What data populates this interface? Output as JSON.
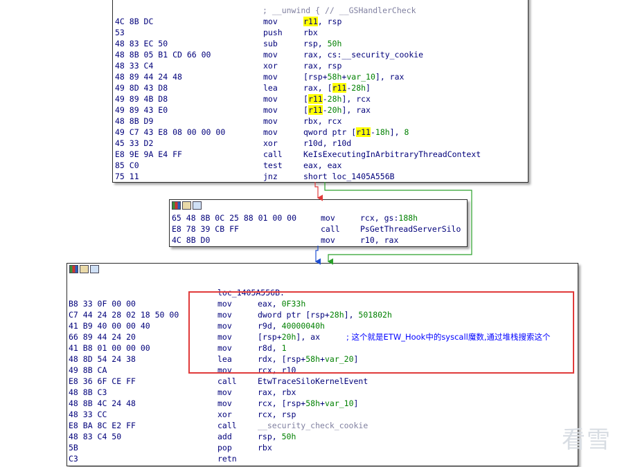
{
  "block1": {
    "header_partial": "; __unwind { // __GSHandlerCheck",
    "lines": [
      {
        "bytes": "4C 8B DC",
        "mn": "mov",
        "ops": [
          {
            "t": "r11",
            "h": true
          },
          {
            "t": ", rsp"
          }
        ]
      },
      {
        "bytes": "53",
        "mn": "push",
        "ops": [
          {
            "t": "rbx"
          }
        ]
      },
      {
        "bytes": "48 83 EC 50",
        "mn": "sub",
        "ops": [
          {
            "t": "rsp, "
          },
          {
            "t": "50h",
            "c": "num"
          }
        ]
      },
      {
        "bytes": "48 8B 05 B1 CD 66 00",
        "mn": "mov",
        "ops": [
          {
            "t": "rax, cs:__security_cookie"
          }
        ]
      },
      {
        "bytes": "48 33 C4",
        "mn": "xor",
        "ops": [
          {
            "t": "rax, rsp"
          }
        ]
      },
      {
        "bytes": "48 89 44 24 48",
        "mn": "mov",
        "ops": [
          {
            "t": "[rsp+"
          },
          {
            "t": "58h",
            "c": "num"
          },
          {
            "t": "+"
          },
          {
            "t": "var_10",
            "c": "var"
          },
          {
            "t": "], rax"
          }
        ]
      },
      {
        "bytes": "49 8D 43 D8",
        "mn": "lea",
        "ops": [
          {
            "t": "rax, ["
          },
          {
            "t": "r11",
            "h": true
          },
          {
            "t": "-"
          },
          {
            "t": "28h",
            "c": "num"
          },
          {
            "t": "]"
          }
        ]
      },
      {
        "bytes": "49 89 4B D8",
        "mn": "mov",
        "ops": [
          {
            "t": "["
          },
          {
            "t": "r11",
            "h": true
          },
          {
            "t": "-"
          },
          {
            "t": "28h",
            "c": "num"
          },
          {
            "t": "], rcx"
          }
        ]
      },
      {
        "bytes": "49 89 43 E0",
        "mn": "mov",
        "ops": [
          {
            "t": "["
          },
          {
            "t": "r11",
            "h": true
          },
          {
            "t": "-"
          },
          {
            "t": "20h",
            "c": "num"
          },
          {
            "t": "], rax"
          }
        ]
      },
      {
        "bytes": "48 8B D9",
        "mn": "mov",
        "ops": [
          {
            "t": "rbx, rcx"
          }
        ]
      },
      {
        "bytes": "49 C7 43 E8 08 00 00 00",
        "mn": "mov",
        "ops": [
          {
            "t": "qword ptr ["
          },
          {
            "t": "r11",
            "h": true
          },
          {
            "t": "-"
          },
          {
            "t": "18h",
            "c": "num"
          },
          {
            "t": "], "
          },
          {
            "t": "8",
            "c": "num"
          }
        ]
      },
      {
        "bytes": "45 33 D2",
        "mn": "xor",
        "ops": [
          {
            "t": "r10d, r10d"
          }
        ]
      },
      {
        "bytes": "E8 9E 9A E4 FF",
        "mn": "call",
        "ops": [
          {
            "t": "KeIsExecutingInArbitraryThreadContext"
          }
        ]
      },
      {
        "bytes": "85 C0",
        "mn": "test",
        "ops": [
          {
            "t": "eax, eax"
          }
        ]
      },
      {
        "bytes": "75 11",
        "mn": "jnz",
        "ops": [
          {
            "t": "short loc_1405A556B"
          }
        ]
      }
    ]
  },
  "block2": {
    "lines": [
      {
        "bytes": "65 48 8B 0C 25 88 01 00 00",
        "mn": "mov",
        "ops": [
          {
            "t": "rcx, gs:"
          },
          {
            "t": "188h",
            "c": "num"
          }
        ]
      },
      {
        "bytes": "E8 78 39 CB FF",
        "mn": "call",
        "ops": [
          {
            "t": "PsGetThreadServerSilo"
          }
        ]
      },
      {
        "bytes": "4C 8B D0",
        "mn": "mov",
        "ops": [
          {
            "t": "r10, rax"
          }
        ]
      }
    ]
  },
  "block3": {
    "label": "loc_1405A556B:",
    "comment": "; 这个就是ETW_Hook中的syscall魔数,通过堆栈搜索这个",
    "lines": [
      {
        "bytes": "B8 33 0F 00 00",
        "mn": "mov",
        "ops": [
          {
            "t": "eax, "
          },
          {
            "t": "0F33h",
            "c": "num"
          }
        ]
      },
      {
        "bytes": "C7 44 24 28 02 18 50 00",
        "mn": "mov",
        "ops": [
          {
            "t": "dword ptr [rsp+"
          },
          {
            "t": "28h",
            "c": "num"
          },
          {
            "t": "], "
          },
          {
            "t": "501802h",
            "c": "num"
          }
        ]
      },
      {
        "bytes": "41 B9 40 00 00 40",
        "mn": "mov",
        "ops": [
          {
            "t": "r9d, "
          },
          {
            "t": "40000040h",
            "c": "num"
          }
        ]
      },
      {
        "bytes": "66 89 44 24 20",
        "mn": "mov",
        "ops": [
          {
            "t": "[rsp+"
          },
          {
            "t": "20h",
            "c": "num"
          },
          {
            "t": "], ax"
          }
        ],
        "comment": true
      },
      {
        "bytes": "41 B8 01 00 00 00",
        "mn": "mov",
        "ops": [
          {
            "t": "r8d, "
          },
          {
            "t": "1",
            "c": "num"
          }
        ]
      },
      {
        "bytes": "48 8D 54 24 38",
        "mn": "lea",
        "ops": [
          {
            "t": "rdx, [rsp+"
          },
          {
            "t": "58h",
            "c": "num"
          },
          {
            "t": "+"
          },
          {
            "t": "var_20",
            "c": "var"
          },
          {
            "t": "]"
          }
        ]
      },
      {
        "bytes": "49 8B CA",
        "mn": "mov",
        "ops": [
          {
            "t": "rcx, r10"
          }
        ]
      },
      {
        "bytes": "E8 36 6F CE FF",
        "mn": "call",
        "ops": [
          {
            "t": "EtwTraceSiloKernelEvent"
          }
        ]
      },
      {
        "bytes": "48 8B C3",
        "mn": "mov",
        "ops": [
          {
            "t": "rax, rbx"
          }
        ]
      },
      {
        "bytes": "48 8B 4C 24 48",
        "mn": "mov",
        "ops": [
          {
            "t": "rcx, [rsp+"
          },
          {
            "t": "58h",
            "c": "num"
          },
          {
            "t": "+"
          },
          {
            "t": "var_10",
            "c": "var"
          },
          {
            "t": "]"
          }
        ]
      },
      {
        "bytes": "48 33 CC",
        "mn": "xor",
        "ops": [
          {
            "t": "rcx, rsp"
          }
        ]
      },
      {
        "bytes": "E8 BA 8C E2 FF",
        "mn": "call",
        "ops": [
          {
            "t": "__security_check_cookie",
            "c": "gray"
          }
        ]
      },
      {
        "bytes": "48 83 C4 50",
        "mn": "add",
        "ops": [
          {
            "t": "rsp, "
          },
          {
            "t": "50h",
            "c": "num"
          }
        ]
      },
      {
        "bytes": "5B",
        "mn": "pop",
        "ops": [
          {
            "t": "rbx"
          }
        ]
      },
      {
        "bytes": "C3",
        "mn": "retn",
        "ops": []
      }
    ]
  },
  "watermark": "看雪",
  "colors": {
    "edge_false": "#e03a3a",
    "edge_true": "#2aa02a",
    "edge_flow": "#1f4fd1",
    "highlight": "#ffff00",
    "annotation": "#e03a3a"
  }
}
